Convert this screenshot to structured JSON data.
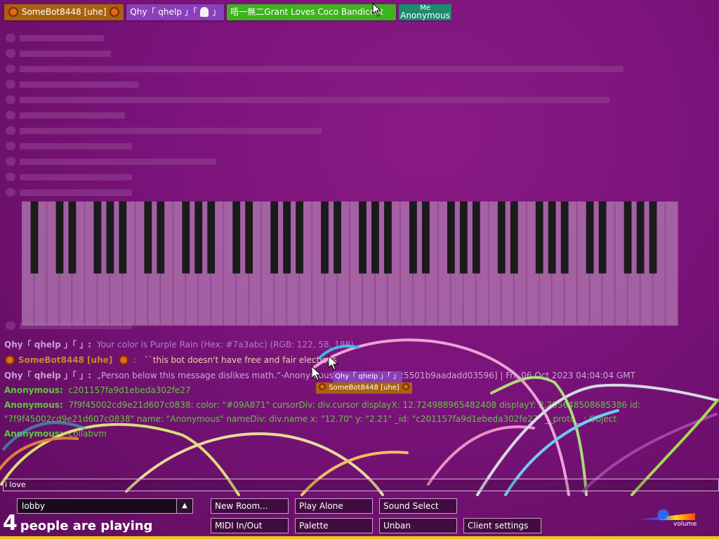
{
  "users": [
    {
      "name": "SomeBot8448 [uhe]",
      "color": "#a8620f",
      "emoji_before": "pumpkin",
      "emoji_after": "pumpkin"
    },
    {
      "name": "Qhy「 qhelp 」「",
      "suffix": "」",
      "color": "#8b3fb8",
      "emoji_after": "ghost"
    },
    {
      "name": "唔一無二Grant Loves Coco Bandicoot",
      "color": "#3db31d"
    },
    {
      "me_label": "Me",
      "name": "Anonymous",
      "color": "#1e8a6e"
    }
  ],
  "chat": {
    "lines": [
      {
        "type": "user",
        "name": "Qhy「 qhelp 」「 」:",
        "name_color": "#c7a0d2",
        "text": "Your color is Purple Rain (Hex: #7a3abc) (RGB: 122, 58, 188)",
        "text_color": "#b07fc8"
      },
      {
        "type": "user",
        "name": "SomeBot8448 [uhe]",
        "name_color": "#c08a2a",
        "text": "``this bot doesn't have free and fair elections",
        "text_color": "#e7d3a8"
      },
      {
        "type": "user",
        "name": "Qhy「 qhelp 」「 」:",
        "name_color": "#c7a0d2",
        "text": "„Person below this message dislikes math.“-Anonymous [AEIOU-571f4e25501b9aadadd03596] | Fri, 06 Oct 2023 04:04:04 GMT",
        "text_color": "#c9a9d6"
      },
      {
        "type": "anon",
        "name": "Anonymous:",
        "name_color": "#5ec83a",
        "text": "c201157fa9d1ebeda302fe27",
        "text_color": "#5ec83a"
      },
      {
        "type": "anon",
        "name": "Anonymous:",
        "name_color": "#5ec83a",
        "text": "7f9f45002cd9e21d607c0838: color: \"#09A871\" cursorDiv: div.cursor displayX: 12.724988965482408 displayY: 2.295648508685386 id:",
        "text_color": "#5ec83a"
      },
      {
        "type": "anon",
        "name": "",
        "name_color": "#5ec83a",
        "text": "\"7f9f45002cd9e21d607c0838\" name: \"Anonymous\" nameDiv: div.name x: \"12.70\" y: \"2.21\" _id: \"c201157fa9d1ebeda302fe27\" __proto__: Object",
        "text_color": "#5ec83a"
      },
      {
        "type": "anon",
        "name": "Anonymous:",
        "name_color": "#5ec83a",
        "text": "collabvm",
        "text_color": "#5ec83a"
      }
    ]
  },
  "cursors": [
    {
      "label": "Qhy「 qhelp 」「 」",
      "color": "#8b3fb8"
    },
    {
      "label": "SomeBot8448 [uhe]",
      "color": "#a8620f"
    }
  ],
  "input": {
    "value": "i love"
  },
  "room": {
    "value": "lobby",
    "arrow": "▲"
  },
  "player_count": {
    "number": "4",
    "text": "people are playing"
  },
  "buttons": {
    "new_room": "New Room...",
    "play_alone": "Play Alone",
    "sound_select": "Sound Select",
    "midi": "MIDI In/Out",
    "palette": "Palette",
    "unban": "Unban",
    "client_settings": "Client settings"
  },
  "volume": {
    "label": "volume",
    "level": 0.5
  }
}
